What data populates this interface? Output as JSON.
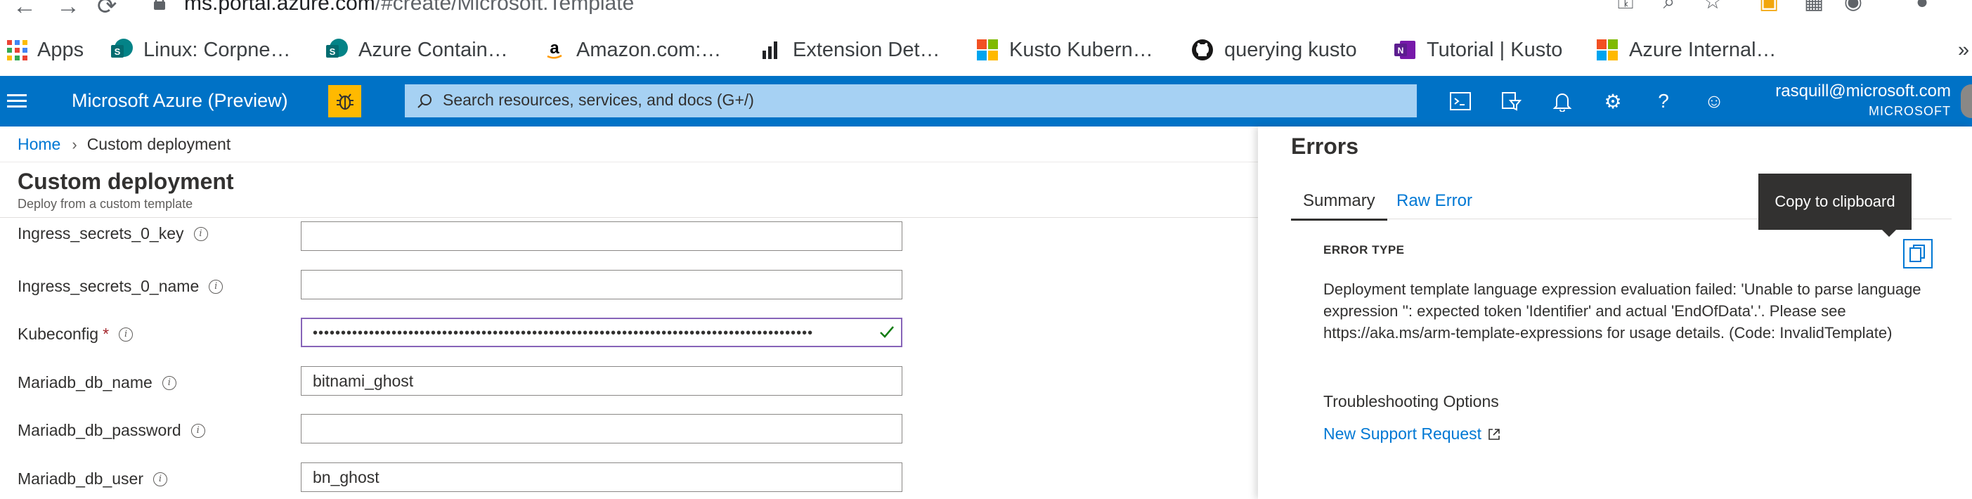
{
  "browser": {
    "url_host": "ms.portal.azure.com",
    "url_path": "/#create/Microsoft.Template",
    "bookmarks": [
      {
        "label": "Apps",
        "icon": "apps-grid-icon"
      },
      {
        "label": "Linux: Corpne…",
        "icon": "sharepoint-icon"
      },
      {
        "label": "Azure Contain…",
        "icon": "sharepoint-icon"
      },
      {
        "label": "Amazon.com:…",
        "icon": "amazon-icon"
      },
      {
        "label": "Extension Det…",
        "icon": "bar-chart-icon"
      },
      {
        "label": "Kusto Kubern…",
        "icon": "microsoft-logo-icon"
      },
      {
        "label": "querying kusto",
        "icon": "github-icon"
      },
      {
        "label": "Tutorial | Kusto",
        "icon": "onenote-icon"
      },
      {
        "label": "Azure Internal…",
        "icon": "microsoft-logo-icon"
      }
    ],
    "more_bookmarks": "»"
  },
  "azure": {
    "title": "Microsoft Azure (Preview)",
    "search_placeholder": "Search resources, services, and docs (G+/)",
    "account_email": "rasquill@microsoft.com",
    "account_org": "MICROSOFT"
  },
  "breadcrumb": {
    "home": "Home",
    "current": "Custom deployment"
  },
  "page": {
    "title": "Custom deployment",
    "subtitle": "Deploy from a custom template"
  },
  "form": {
    "fields": [
      {
        "label": "Ingress_secrets_0_key",
        "value": "",
        "required": false
      },
      {
        "label": "Ingress_secrets_0_name",
        "value": "",
        "required": false
      },
      {
        "label": "Kubeconfig",
        "value": "•••••••••••••••••••••••••••••••••••••••••••••••••••••••••••••••••••••••••••••••••••••••••",
        "required": true
      },
      {
        "label": "Mariadb_db_name",
        "value": "bitnami_ghost",
        "required": false
      },
      {
        "label": "Mariadb_db_password",
        "value": "",
        "required": false
      },
      {
        "label": "Mariadb_db_user",
        "value": "bn_ghost",
        "required": false
      }
    ],
    "required_mark": "*"
  },
  "errors": {
    "title": "Errors",
    "tabs": [
      "Summary",
      "Raw Error"
    ],
    "error_type_label": "ERROR TYPE",
    "message": "Deployment template language expression evaluation failed: 'Unable to parse language expression '': expected token 'Identifier' and actual 'EndOfData'.'. Please see https://aka.ms/arm-template-expressions for usage details. (Code: InvalidTemplate)",
    "troubleshooting_label": "Troubleshooting Options",
    "support_link": "New Support Request",
    "copy_tooltip": "Copy to clipboard"
  },
  "colors": {
    "azure_blue": "#0072c6",
    "link": "#0078d4",
    "search_bg": "#a6d1f3",
    "bug_badge": "#ffb900",
    "focus_border": "#8764b8",
    "valid_check": "#107c10",
    "required": "#a4262c"
  }
}
